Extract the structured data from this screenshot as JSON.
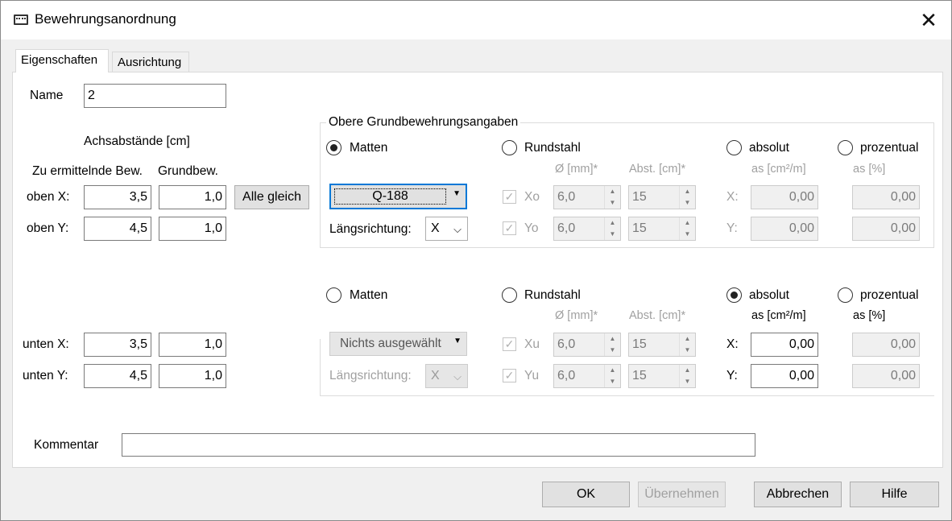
{
  "window": {
    "title": "Bewehrungsanordnung",
    "close_glyph": "✕"
  },
  "tabs": [
    {
      "label": "Eigenschaften",
      "active": true
    },
    {
      "label": "Ausrichtung",
      "active": false
    }
  ],
  "left": {
    "name_label": "Name",
    "name_value": "2",
    "achs_label": "Achsabstände [cm]",
    "col1_header": "Zu ermittelnde Bew.",
    "col2_header": "Grundbew.",
    "rows": [
      {
        "label": "oben X:",
        "v1": "3,5",
        "v2": "1,0"
      },
      {
        "label": "oben Y:",
        "v1": "4,5",
        "v2": "1,0"
      },
      {
        "label": "unten X:",
        "v1": "3,5",
        "v2": "1,0"
      },
      {
        "label": "unten Y:",
        "v1": "4,5",
        "v2": "1,0"
      }
    ],
    "alle_gleich": "Alle gleich"
  },
  "upper": {
    "group_title": "Obere Grundbewehrungsangaben",
    "radio_matten": "Matten",
    "radio_rundstahl": "Rundstahl",
    "radio_absolut": "absolut",
    "radio_prozentual": "prozentual",
    "selected_type": "Matten",
    "selected_mode": "absolut",
    "header_d": "Ø [mm]*",
    "header_abst": "Abst. [cm]*",
    "header_as_abs": "as [cm²/m]",
    "header_as_pct": "as [%]",
    "combo_value": "Q-188",
    "laengs_label": "Längsrichtung:",
    "laengs_value": "X",
    "row_x": {
      "label": "Xo",
      "d": "6,0",
      "abst": "15",
      "axis": "X:",
      "abs": "0,00",
      "pct": "0,00"
    },
    "row_y": {
      "label": "Yo",
      "d": "6,0",
      "abst": "15",
      "axis": "Y:",
      "abs": "0,00",
      "pct": "0,00"
    }
  },
  "lower": {
    "radio_matten": "Matten",
    "radio_rundstahl": "Rundstahl",
    "radio_absolut": "absolut",
    "radio_prozentual": "prozentual",
    "selected_mode": "absolut",
    "header_d": "Ø [mm]*",
    "header_abst": "Abst. [cm]*",
    "header_as_abs": "as [cm²/m]",
    "header_as_pct": "as [%]",
    "combo_value": "Nichts ausgewählt",
    "laengs_label": "Längsrichtung:",
    "laengs_value": "X",
    "row_x": {
      "label": "Xu",
      "d": "6,0",
      "abst": "15",
      "axis": "X:",
      "abs": "0,00",
      "pct": "0,00"
    },
    "row_y": {
      "label": "Yu",
      "d": "6,0",
      "abst": "15",
      "axis": "Y:",
      "abs": "0,00",
      "pct": "0,00"
    }
  },
  "comment": {
    "label": "Kommentar",
    "value": ""
  },
  "footer": {
    "ok": "OK",
    "apply": "Übernehmen",
    "cancel": "Abbrechen",
    "help": "Hilfe"
  },
  "icons": {
    "up_arrow": "▲",
    "down_arrow": "▼",
    "check": "✓",
    "caret": "▼",
    "chevron": "⌵"
  }
}
